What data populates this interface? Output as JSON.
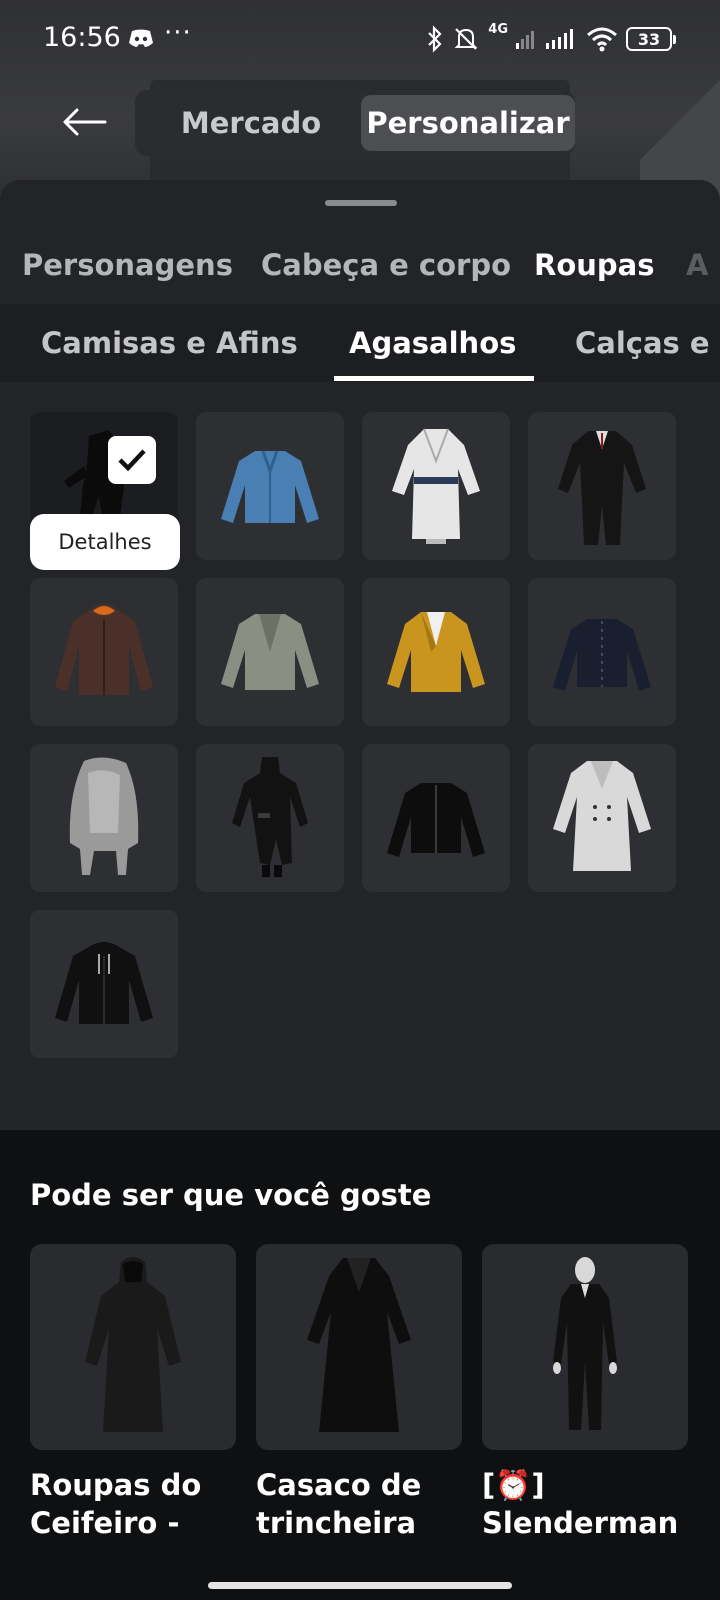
{
  "status_bar": {
    "time": "16:56",
    "more": "···",
    "network": "4G",
    "battery": "33"
  },
  "header": {
    "segments": [
      "Mercado",
      "Personalizar"
    ],
    "active_segment": "Personalizar"
  },
  "category_tabs": {
    "items": [
      "Personagens",
      "Cabeça e corpo",
      "Roupas",
      "A"
    ],
    "active": "Roupas"
  },
  "sub_tabs": {
    "items": [
      "Camisas e Afins",
      "Agasalhos",
      "Calças e"
    ],
    "active": "Agasalhos"
  },
  "grid": {
    "details_label": "Detalhes",
    "items": [
      {
        "icon": "dark-hooded-figure",
        "selected": true
      },
      {
        "icon": "denim-jacket"
      },
      {
        "icon": "white-robe"
      },
      {
        "icon": "black-suit"
      },
      {
        "icon": "brown-parka"
      },
      {
        "icon": "gray-blazer"
      },
      {
        "icon": "gold-blazer"
      },
      {
        "icon": "navy-jacket"
      },
      {
        "icon": "fur-coat"
      },
      {
        "icon": "black-long-coat-figure"
      },
      {
        "icon": "black-leather-jacket"
      },
      {
        "icon": "white-trench-coat"
      },
      {
        "icon": "black-hoodie"
      }
    ]
  },
  "recommendations": {
    "title": "Pode ser que você goste",
    "items": [
      {
        "name": "Roupas do Ceifeiro -"
      },
      {
        "name": "Casaco de trincheira de"
      },
      {
        "name": "[⏰] Slenderman"
      }
    ]
  },
  "colors": {
    "background": "#16171a",
    "sheet": "#232427",
    "tile": "#2e2f33",
    "active_segment": "#4d4e52"
  }
}
